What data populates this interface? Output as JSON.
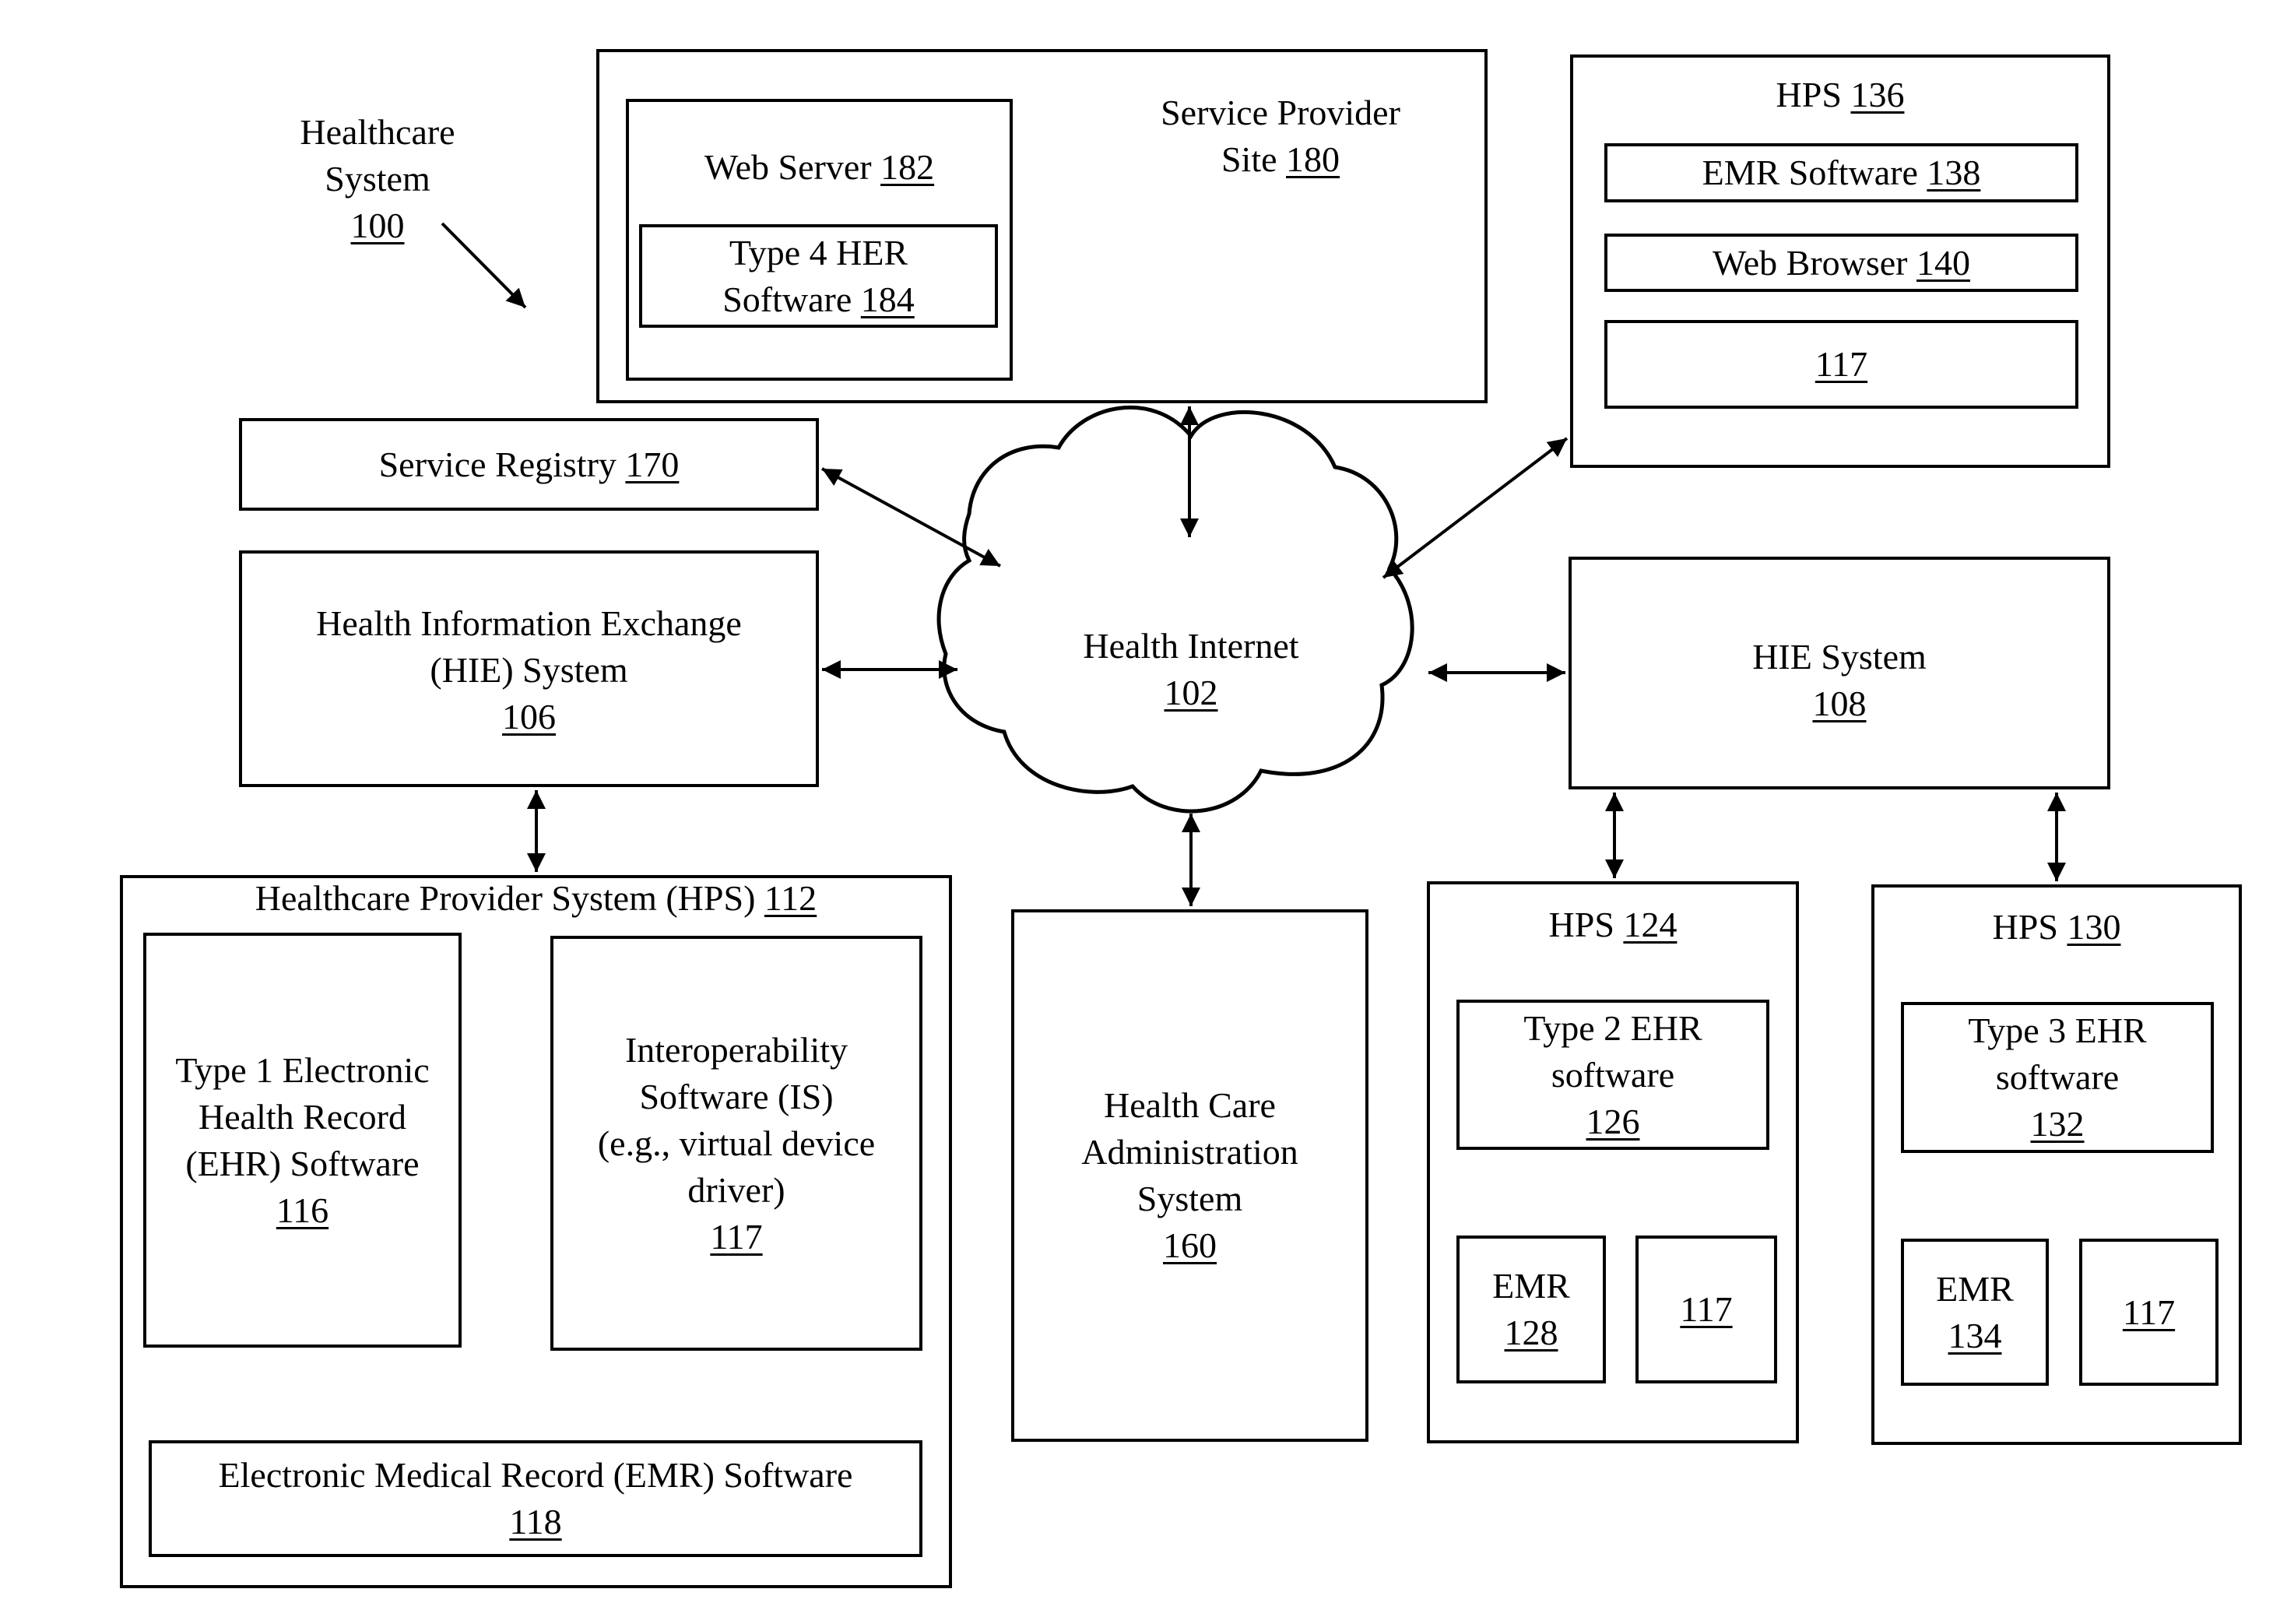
{
  "diagram": {
    "system_label": {
      "lines": [
        "Healthcare",
        "System"
      ],
      "ref": "100"
    },
    "service_provider_site": {
      "lines": [
        "Service Provider"
      ],
      "prefix": "Site",
      "ref": "180"
    },
    "web_server": {
      "text": "Web Server",
      "ref": "182"
    },
    "type4_software": {
      "line1": "Type 4 HER",
      "line2": "Software",
      "ref": "184"
    },
    "hps_136": {
      "text": "HPS",
      "ref": "136"
    },
    "emr_software_138": {
      "text": "EMR Software",
      "ref": "138"
    },
    "web_browser_140": {
      "text": "Web Browser",
      "ref": "140"
    },
    "is_box_136": {
      "ref": "117"
    },
    "service_registry": {
      "text": "Service Registry",
      "ref": "170"
    },
    "hie_106": {
      "line1": "Health Information Exchange",
      "line2": "(HIE) System",
      "ref": "106"
    },
    "health_internet": {
      "text": "Health Internet",
      "ref": "102"
    },
    "hie_108": {
      "text": "HIE System",
      "ref": "108"
    },
    "hps_112": {
      "text": "Healthcare Provider System (HPS)",
      "ref": "112"
    },
    "ehr_116": {
      "lines": [
        "Type 1 Electronic",
        "Health Record",
        "(EHR) Software"
      ],
      "ref": "116"
    },
    "is_117": {
      "lines": [
        "Interoperability",
        "Software (IS)",
        "(e.g., virtual device",
        "driver)"
      ],
      "ref": "117"
    },
    "emr_118": {
      "text": "Electronic Medical Record (EMR) Software",
      "ref": "118"
    },
    "hca_160": {
      "lines": [
        "Health Care",
        "Administration",
        "System"
      ],
      "ref": "160"
    },
    "hps_124": {
      "text": "HPS",
      "ref": "124"
    },
    "ehr_126": {
      "lines": [
        "Type 2 EHR",
        "software"
      ],
      "ref": "126"
    },
    "emr_128": {
      "text": "EMR",
      "ref": "128"
    },
    "is_124": {
      "ref": "117"
    },
    "hps_130": {
      "text": "HPS",
      "ref": "130"
    },
    "ehr_132": {
      "lines": [
        "Type 3 EHR",
        "software"
      ],
      "ref": "132"
    },
    "emr_134": {
      "text": "EMR",
      "ref": "134"
    },
    "is_130": {
      "ref": "117"
    }
  }
}
